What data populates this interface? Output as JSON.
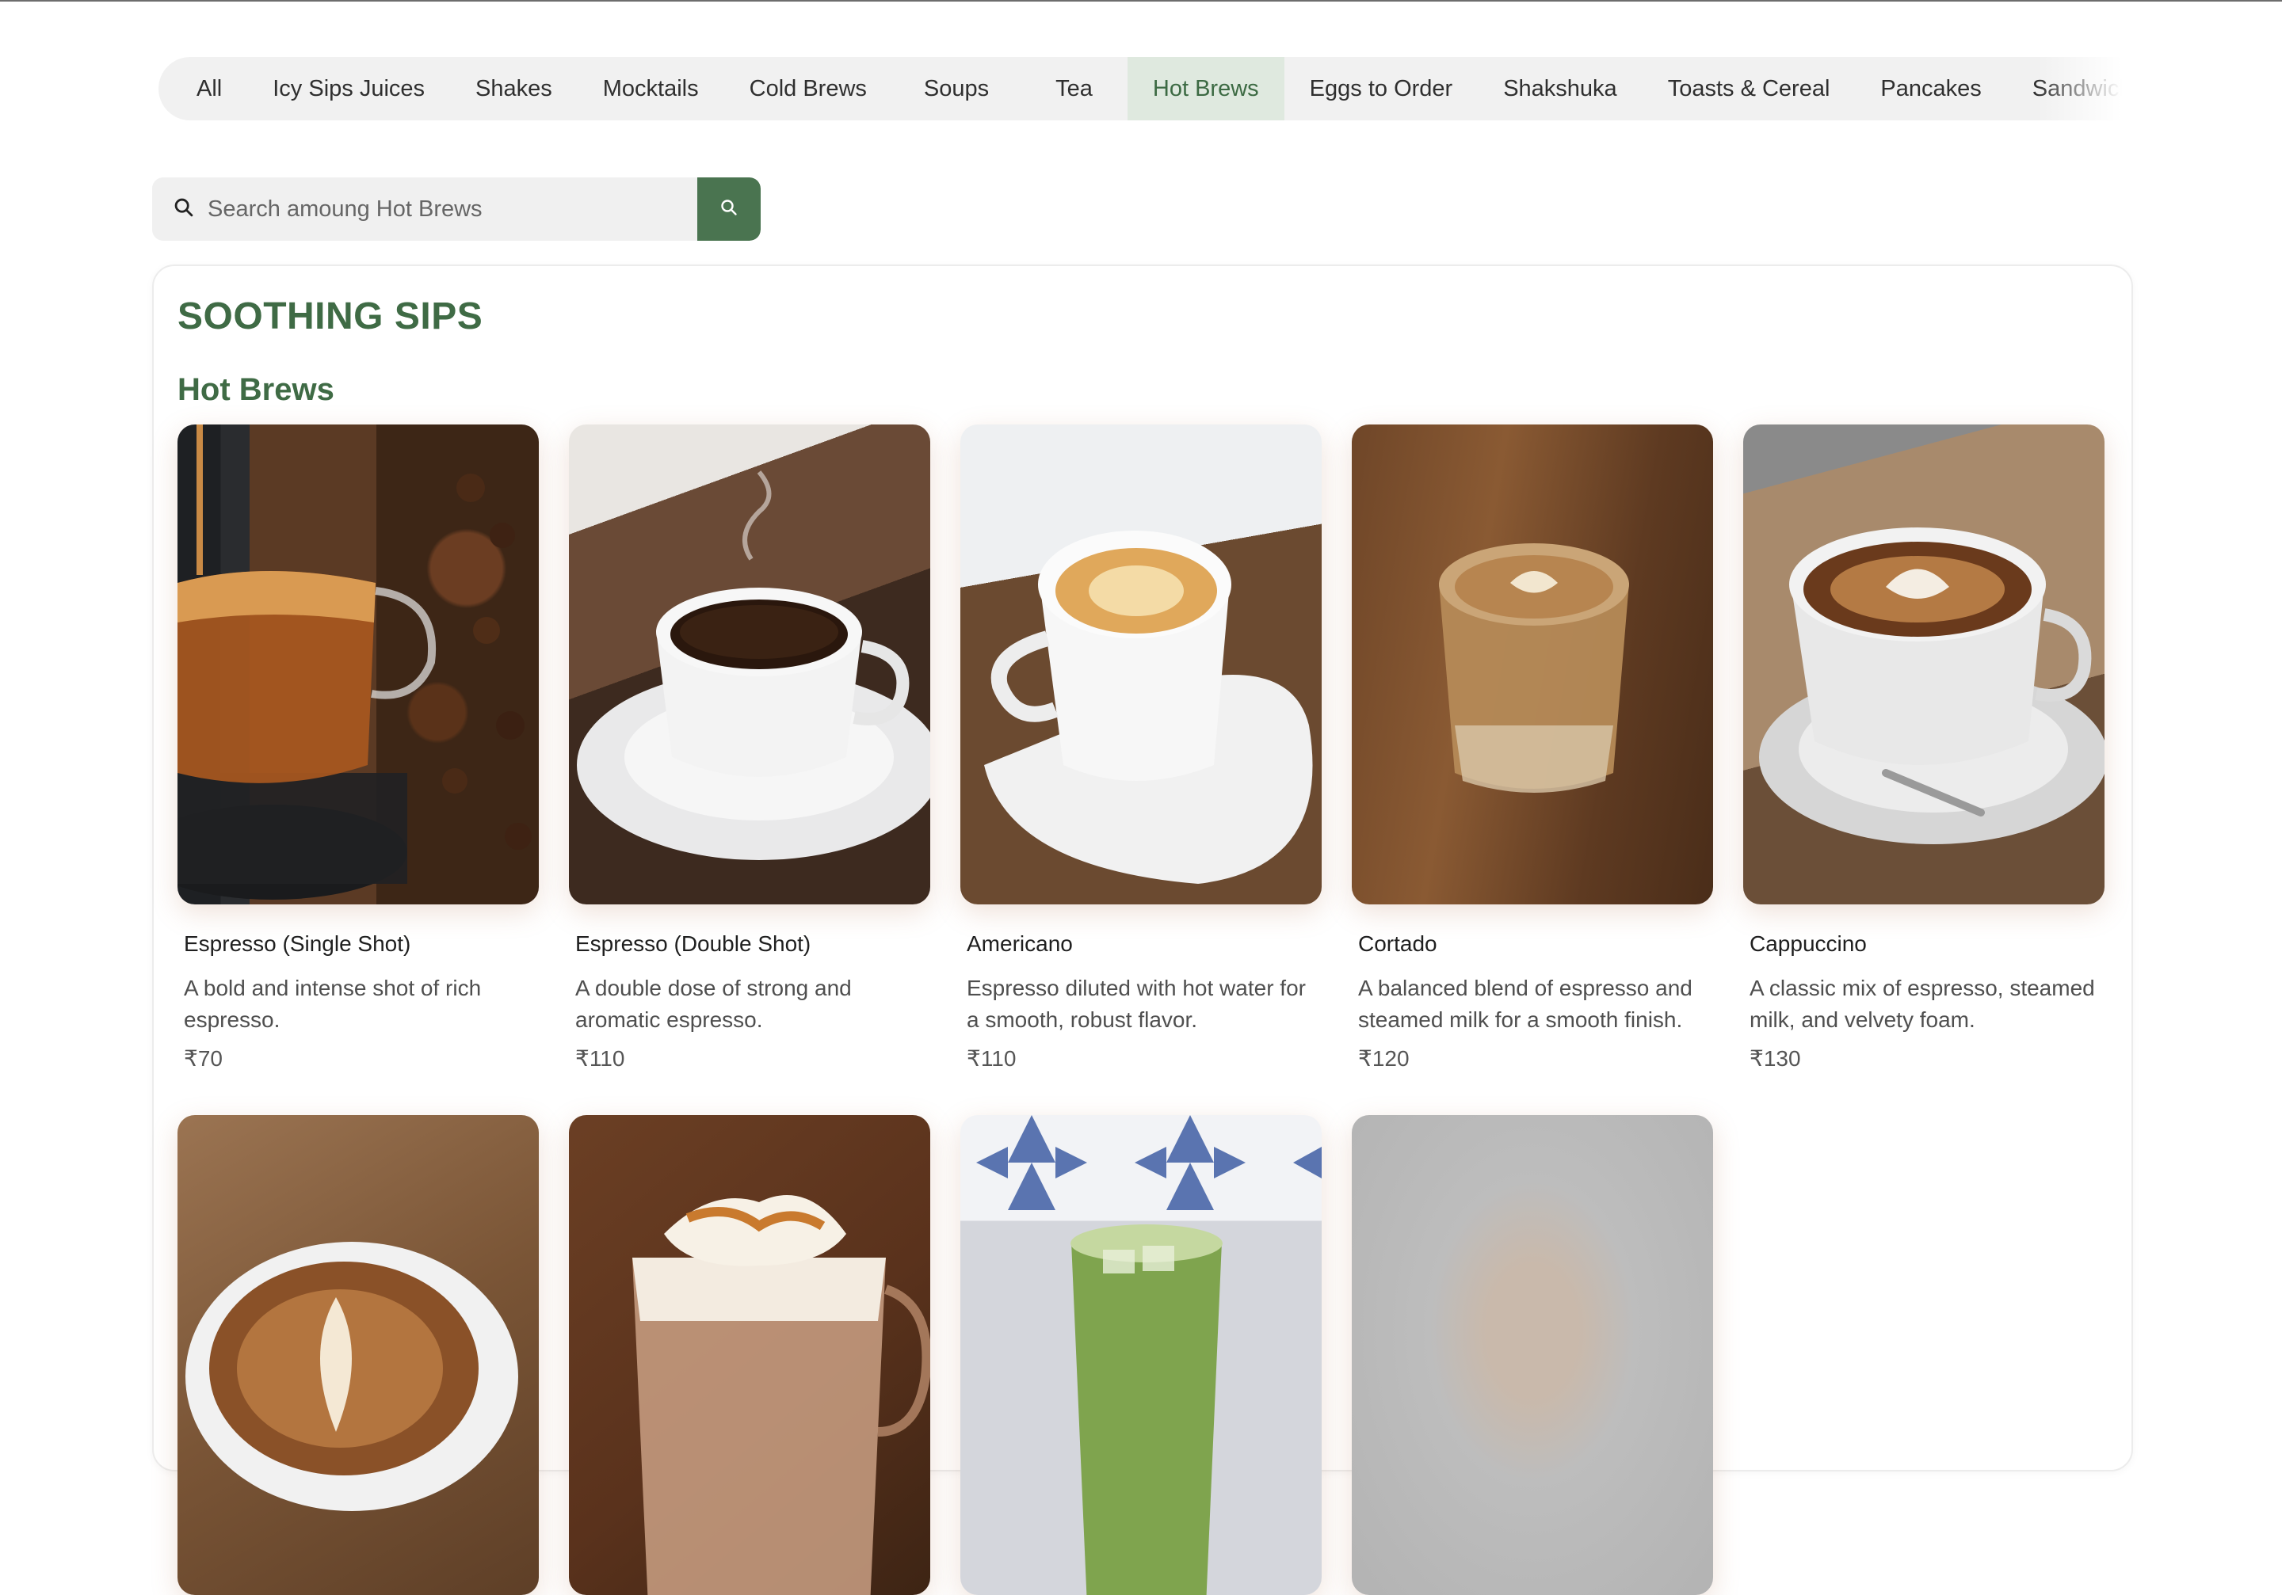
{
  "nav": {
    "categories": [
      {
        "label": "All",
        "active": false
      },
      {
        "label": "Icy Sips Juices",
        "active": false
      },
      {
        "label": "Shakes",
        "active": false
      },
      {
        "label": "Mocktails",
        "active": false
      },
      {
        "label": "Cold Brews",
        "active": false
      },
      {
        "label": "Soups",
        "active": false
      },
      {
        "label": "Tea",
        "active": false
      },
      {
        "label": "Hot Brews",
        "active": true
      },
      {
        "label": "Eggs to Order",
        "active": false
      },
      {
        "label": "Shakshuka",
        "active": false
      },
      {
        "label": "Toasts & Cereal",
        "active": false
      },
      {
        "label": "Pancakes",
        "active": false
      },
      {
        "label": "Sandwiches",
        "active": false
      }
    ]
  },
  "search": {
    "placeholder": "Search amoung Hot Brews",
    "value": ""
  },
  "section": {
    "title": "SOOTHING SIPS",
    "subtitle": "Hot Brews"
  },
  "products": [
    {
      "name": "Espresso (Single Shot)",
      "description": "A bold and intense shot of rich espresso.",
      "price": "₹70"
    },
    {
      "name": "Espresso (Double Shot)",
      "description": "A double dose of strong and aromatic espresso.",
      "price": "₹110"
    },
    {
      "name": "Americano",
      "description": "Espresso diluted with hot water for a smooth, robust flavor.",
      "price": "₹110"
    },
    {
      "name": "Cortado",
      "description": "A balanced blend of espresso and steamed milk for a smooth finish.",
      "price": "₹120"
    },
    {
      "name": "Cappuccino",
      "description": "A classic mix of espresso, steamed milk, and velvety foam.",
      "price": "₹130"
    }
  ],
  "colors": {
    "brand_green": "#3f6b45",
    "search_button": "#4a7450",
    "active_tab_bg": "#dfe9df",
    "nav_bg": "#f1f1f1"
  },
  "icons": {
    "search": "search-icon",
    "search_button": "search-icon"
  }
}
